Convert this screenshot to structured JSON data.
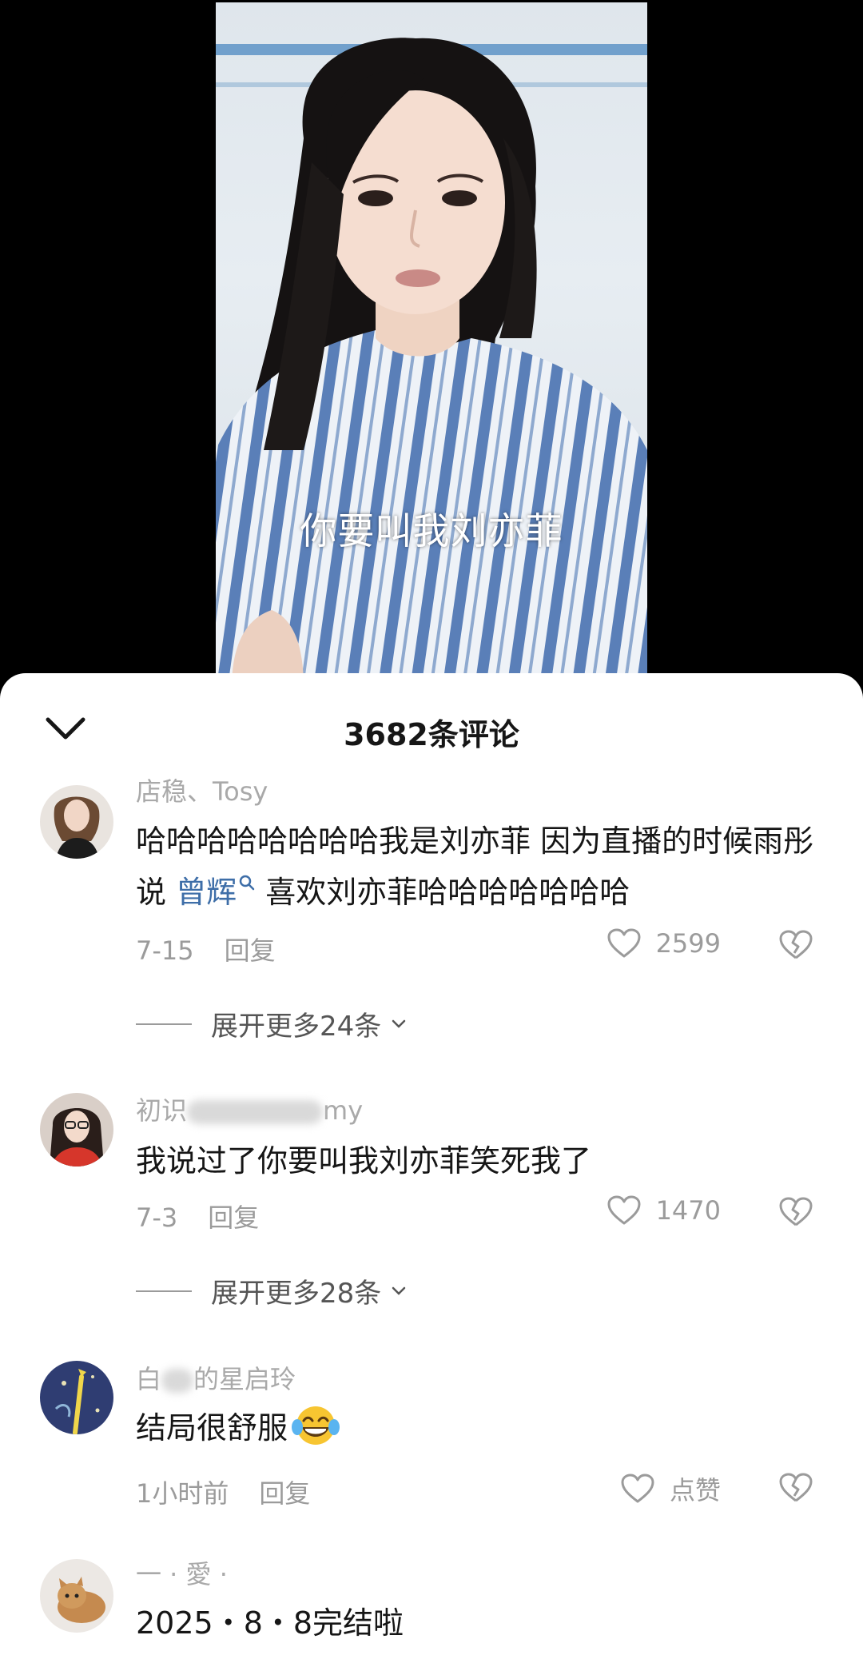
{
  "video": {
    "subtitle": "你要叫我刘亦菲"
  },
  "sheet": {
    "title": "3682条评论"
  },
  "comments": [
    {
      "username": "店稳、Tosy",
      "text_before": "哈哈哈哈哈哈哈哈我是刘亦菲 因为直播的时候雨彤说 ",
      "mention": "曾辉",
      "text_after": " 喜欢刘亦菲哈哈哈哈哈哈哈",
      "date": "7-15",
      "reply": "回复",
      "likes": "2599",
      "expand": "展开更多24条"
    },
    {
      "username_visible": "初识",
      "username_tail": "my",
      "text": "我说过了你要叫我刘亦菲笑死我了",
      "date": "7-3",
      "reply": "回复",
      "likes": "1470",
      "expand": "展开更多28条"
    },
    {
      "username_visible": "白",
      "username_tail": "的星启玲",
      "text": "结局很舒服",
      "emoji": "face-with-tears-of-joy",
      "date": "1小时前",
      "reply": "回复",
      "likes": "点赞"
    },
    {
      "username": "一 · 愛 ·",
      "text": "2025・8・8完结啦"
    }
  ],
  "colors": {
    "mention": "#3e6ea8",
    "meta": "#9b9b9b",
    "text": "#161616"
  }
}
